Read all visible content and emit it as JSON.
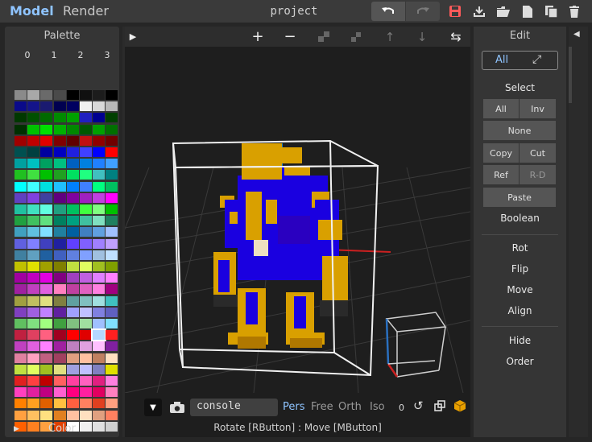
{
  "topbar": {
    "tab_model": "Model",
    "tab_render": "Render",
    "project_title": "project",
    "icons": [
      "undo-icon",
      "redo-icon",
      "save-icon",
      "download-icon",
      "open-folder-icon",
      "new-file-icon",
      "copy-file-icon",
      "delete-icon"
    ]
  },
  "palette": {
    "title": "Palette",
    "columns": [
      "0",
      "1",
      "2",
      "3"
    ],
    "color_label": "Color",
    "selected_swatch": "row 21, col 3",
    "swatches": [
      [
        "#8a8a8a",
        "#a8a8a8",
        "#6a6a6a",
        "#4a4a4a",
        "#000000",
        "#101010",
        "#1c1c1c",
        "#000000"
      ],
      [
        "#0a0a8a",
        "#14148a",
        "#1a1a70",
        "#000050",
        "#000060",
        "#f0f0f0",
        "#d8d8d8",
        "#b8b8b8"
      ],
      [
        "#003800",
        "#005000",
        "#006a00",
        "#008a00",
        "#00a000",
        "#2020c0",
        "#000090",
        "#004000"
      ],
      [
        "#003000",
        "#00c000",
        "#00e000",
        "#00b000",
        "#008800",
        "#005800",
        "#00a000",
        "#007000"
      ],
      [
        "#a00000",
        "#c00000",
        "#e00000",
        "#800000",
        "#600000",
        "#c01010",
        "#900000",
        "#700000"
      ],
      [
        "#005050",
        "#004040",
        "#0000a0",
        "#0000c0",
        "#2020e0",
        "#4040ff",
        "#0000ff",
        "#ff0000"
      ],
      [
        "#00a0a0",
        "#00c0c0",
        "#00a060",
        "#00c080",
        "#0060c0",
        "#0080e0",
        "#2080ff",
        "#40a0ff"
      ],
      [
        "#20c020",
        "#40e040",
        "#00c000",
        "#20a020",
        "#00e060",
        "#20ff80",
        "#40c0c0",
        "#008080"
      ],
      [
        "#00ffff",
        "#40ffff",
        "#00e0e0",
        "#20c0ff",
        "#0080ff",
        "#4080ff",
        "#00ff80",
        "#00c060"
      ],
      [
        "#6040c0",
        "#8040e0",
        "#4040a0",
        "#600080",
        "#8000a0",
        "#a020c0",
        "#c040e0",
        "#ff00ff"
      ],
      [
        "#20c0a0",
        "#40e0c0",
        "#60ffe0",
        "#20a080",
        "#00c060",
        "#40ff40",
        "#80ff80",
        "#00c000"
      ],
      [
        "#20a040",
        "#40c060",
        "#60e080",
        "#008060",
        "#00a080",
        "#40c0a0",
        "#80e0c0",
        "#208060"
      ],
      [
        "#40a0c0",
        "#60c0e0",
        "#80e0ff",
        "#2080a0",
        "#0060a0",
        "#4080c0",
        "#60a0e0",
        "#a0c0ff"
      ],
      [
        "#6060e0",
        "#8080ff",
        "#4040c0",
        "#2020a0",
        "#6040ff",
        "#8060ff",
        "#a080ff",
        "#c0a0ff"
      ],
      [
        "#4080a0",
        "#60a0c0",
        "#2060a0",
        "#4060c0",
        "#6080e0",
        "#80a0ff",
        "#a0c0e0",
        "#c0e0ff"
      ],
      [
        "#c0c000",
        "#e0e000",
        "#a0a000",
        "#808000",
        "#c0e040",
        "#e0ff60",
        "#a0c020",
        "#80a000"
      ],
      [
        "#a000a0",
        "#c000c0",
        "#e000e0",
        "#800080",
        "#a040c0",
        "#c060e0",
        "#e080ff",
        "#ff80ff"
      ],
      [
        "#a020a0",
        "#c040c0",
        "#e060e0",
        "#ff80c0",
        "#c040a0",
        "#e060c0",
        "#ff80e0",
        "#a00080"
      ],
      [
        "#a0a040",
        "#c0c060",
        "#e0e080",
        "#808040",
        "#60a0a0",
        "#80c0c0",
        "#a0e0e0",
        "#40c0c0"
      ],
      [
        "#8040c0",
        "#a060e0",
        "#c080ff",
        "#6020a0",
        "#a0a0ff",
        "#c0c0ff",
        "#8080e0",
        "#6060c0"
      ],
      [
        "#60c060",
        "#80e080",
        "#a0ff80",
        "#40a040",
        "#80c080",
        "#a0e0a0",
        "#a0c0ff",
        "#80e0ff"
      ],
      [
        "#c02040",
        "#e04060",
        "#ff6080",
        "#a00020",
        "#ff0000",
        "#e00000",
        "#c00000",
        "#ff2020"
      ],
      [
        "#c040c0",
        "#e060e0",
        "#ff80ff",
        "#a020a0",
        "#c080c0",
        "#e0a0e0",
        "#ffc0ff",
        "#8020a0"
      ],
      [
        "#e080a0",
        "#ffa0c0",
        "#c06080",
        "#a04060",
        "#e0a080",
        "#ffc0a0",
        "#c08060",
        "#ffe0c0"
      ],
      [
        "#c0e040",
        "#e0ff60",
        "#a0c020",
        "#e0e080",
        "#a0a0e0",
        "#c0c0ff",
        "#8080c0",
        "#e0e000"
      ],
      [
        "#e02020",
        "#ff4040",
        "#c00000",
        "#ff6060",
        "#ff40a0",
        "#ff60c0",
        "#e02080",
        "#ff80e0"
      ],
      [
        "#ff40c0",
        "#e020a0",
        "#c00080",
        "#ff60d0",
        "#ff0080",
        "#ff20a0",
        "#e00060",
        "#ff80c0"
      ],
      [
        "#ff8000",
        "#ffa020",
        "#e06000",
        "#ffc040",
        "#ff6040",
        "#ff8060",
        "#e04020",
        "#ffa080"
      ],
      [
        "#ffa040",
        "#ffc060",
        "#ffe080",
        "#e08020",
        "#ffc0a0",
        "#ffe0c0",
        "#e0a080",
        "#ff8060"
      ],
      [
        "#ff6000",
        "#ff8020",
        "#ffa040",
        "#e04000",
        "#ffffff",
        "#f0f0f0",
        "#e0e0e0",
        "#d0d0d0"
      ]
    ]
  },
  "viewport": {
    "toolbar_icons": [
      "collapse-left-icon",
      "add-icon",
      "remove-icon",
      "grid-icon",
      "grid-small-icon",
      "arrow-up-icon",
      "arrow-down-icon",
      "swap-icon"
    ],
    "console_text": "console",
    "projections": [
      "Pers",
      "Free",
      "Orth",
      "Iso"
    ],
    "active_projection": "Pers",
    "zoom_value": "0",
    "status": "Rotate [RButton] : Move [MButton]"
  },
  "edit": {
    "title": "Edit",
    "mode_label": "All",
    "select_label": "Select",
    "btn_all": "All",
    "btn_inv": "Inv",
    "btn_none": "None",
    "btn_copy": "Copy",
    "btn_cut": "Cut",
    "btn_ref": "Ref",
    "btn_rd": "R-D",
    "btn_paste": "Paste",
    "boolean_label": "Boolean",
    "rot": "Rot",
    "flip": "Flip",
    "move": "Move",
    "align": "Align",
    "hide": "Hide",
    "order": "Order"
  },
  "colors": {
    "accent": "#8fc4ff",
    "save_icon": "#ff5a5a",
    "model_blue": "#1a00e0",
    "model_gold": "#d9a000"
  }
}
